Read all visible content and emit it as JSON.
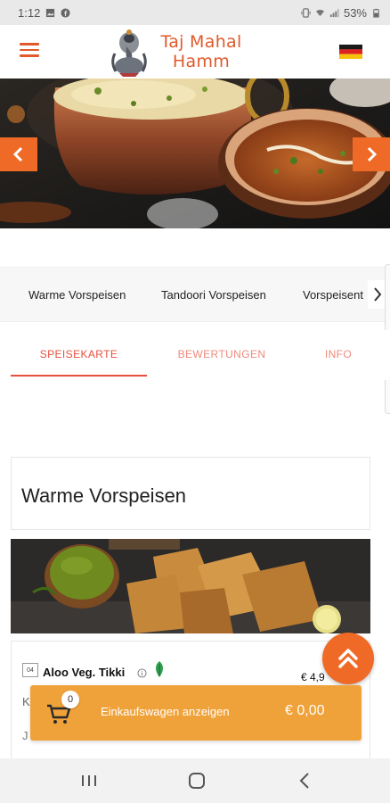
{
  "status_bar": {
    "time": "1:12",
    "battery_text": "53%"
  },
  "header": {
    "logo_line1": "Taj Mahal",
    "logo_line2": "Hamm",
    "menu_icon": "hamburger-icon",
    "language_flag": "german-flag-icon"
  },
  "hero": {
    "prev_icon": "chevron-left-icon",
    "next_icon": "chevron-right-icon"
  },
  "categories": {
    "items": [
      "Warme Vorspeisen",
      "Tandoori Vorspeisen",
      "Vorspeisent"
    ],
    "next_icon": "chevron-right-icon"
  },
  "tabs": {
    "items": [
      "SPEISEKARTE",
      "BEWERTUNGEN",
      "INFO"
    ],
    "active_index": 0
  },
  "section": {
    "title": "Warme Vorspeisen"
  },
  "product": {
    "number": "04",
    "name": "Aloo Veg. Tikki",
    "price": "€ 4,9",
    "desc_line1": "K",
    "desc_line2": "J"
  },
  "cart": {
    "count": "0",
    "label": "Einkaufswagen anzeigen",
    "total": "€ 0,00"
  },
  "colors": {
    "accent": "#ef6a26",
    "brand_red": "#e05a2b",
    "cart_bar": "#f0a23a",
    "tab_active": "#e8503c"
  }
}
